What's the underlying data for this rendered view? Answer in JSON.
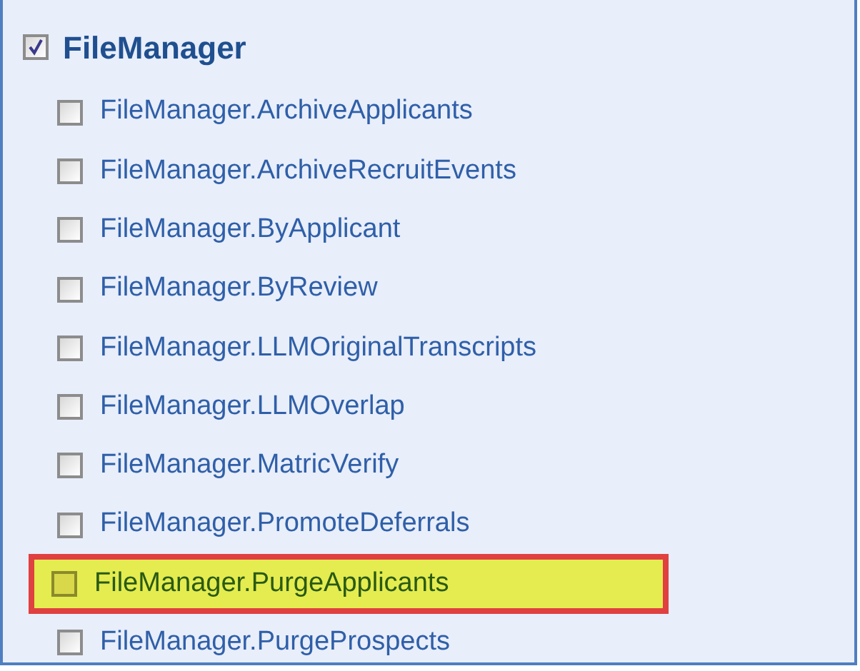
{
  "group": {
    "label": "FileManager",
    "checked": true,
    "items": [
      {
        "label": "FileManager.ArchiveApplicants",
        "checked": false,
        "highlighted": false
      },
      {
        "label": "FileManager.ArchiveRecruitEvents",
        "checked": false,
        "highlighted": false
      },
      {
        "label": "FileManager.ByApplicant",
        "checked": false,
        "highlighted": false
      },
      {
        "label": "FileManager.ByReview",
        "checked": false,
        "highlighted": false
      },
      {
        "label": "FileManager.LLMOriginalTranscripts",
        "checked": false,
        "highlighted": false
      },
      {
        "label": "FileManager.LLMOverlap",
        "checked": false,
        "highlighted": false
      },
      {
        "label": "FileManager.MatricVerify",
        "checked": false,
        "highlighted": false
      },
      {
        "label": "FileManager.PromoteDeferrals",
        "checked": false,
        "highlighted": false
      },
      {
        "label": "FileManager.PurgeApplicants",
        "checked": false,
        "highlighted": true
      },
      {
        "label": "FileManager.PurgeProspects",
        "checked": false,
        "highlighted": false
      }
    ]
  }
}
